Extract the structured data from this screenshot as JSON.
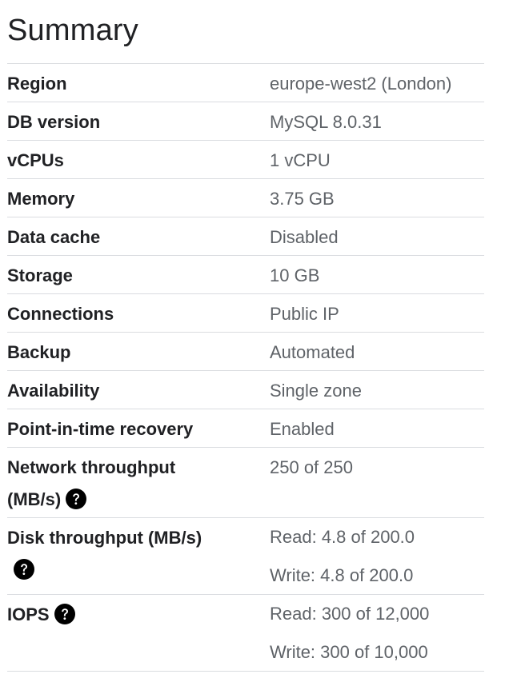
{
  "summary": {
    "title": "Summary",
    "rows": [
      {
        "label": "Region",
        "value": "europe-west2 (London)"
      },
      {
        "label": "DB version",
        "value": "MySQL 8.0.31"
      },
      {
        "label": "vCPUs",
        "value": "1 vCPU"
      },
      {
        "label": "Memory",
        "value": "3.75 GB"
      },
      {
        "label": "Data cache",
        "value": "Disabled"
      },
      {
        "label": "Storage",
        "value": "10 GB"
      },
      {
        "label": "Connections",
        "value": "Public IP"
      },
      {
        "label": "Backup",
        "value": "Automated"
      },
      {
        "label": "Availability",
        "value": "Single zone"
      },
      {
        "label": "Point-in-time recovery",
        "value": "Enabled"
      }
    ],
    "network_throughput": {
      "label_line1": "Network throughput",
      "label_line2": "(MB/s)",
      "value": "250 of 250",
      "help_icon": "help-circle-icon"
    },
    "disk_throughput": {
      "label": "Disk throughput (MB/s)",
      "read": "Read: 4.8 of 200.0",
      "write": "Write: 4.8 of 200.0",
      "help_icon": "help-circle-icon"
    },
    "iops": {
      "label": "IOPS",
      "read": "Read: 300 of 12,000",
      "write": "Write: 300 of 10,000",
      "help_icon": "help-circle-icon"
    }
  }
}
